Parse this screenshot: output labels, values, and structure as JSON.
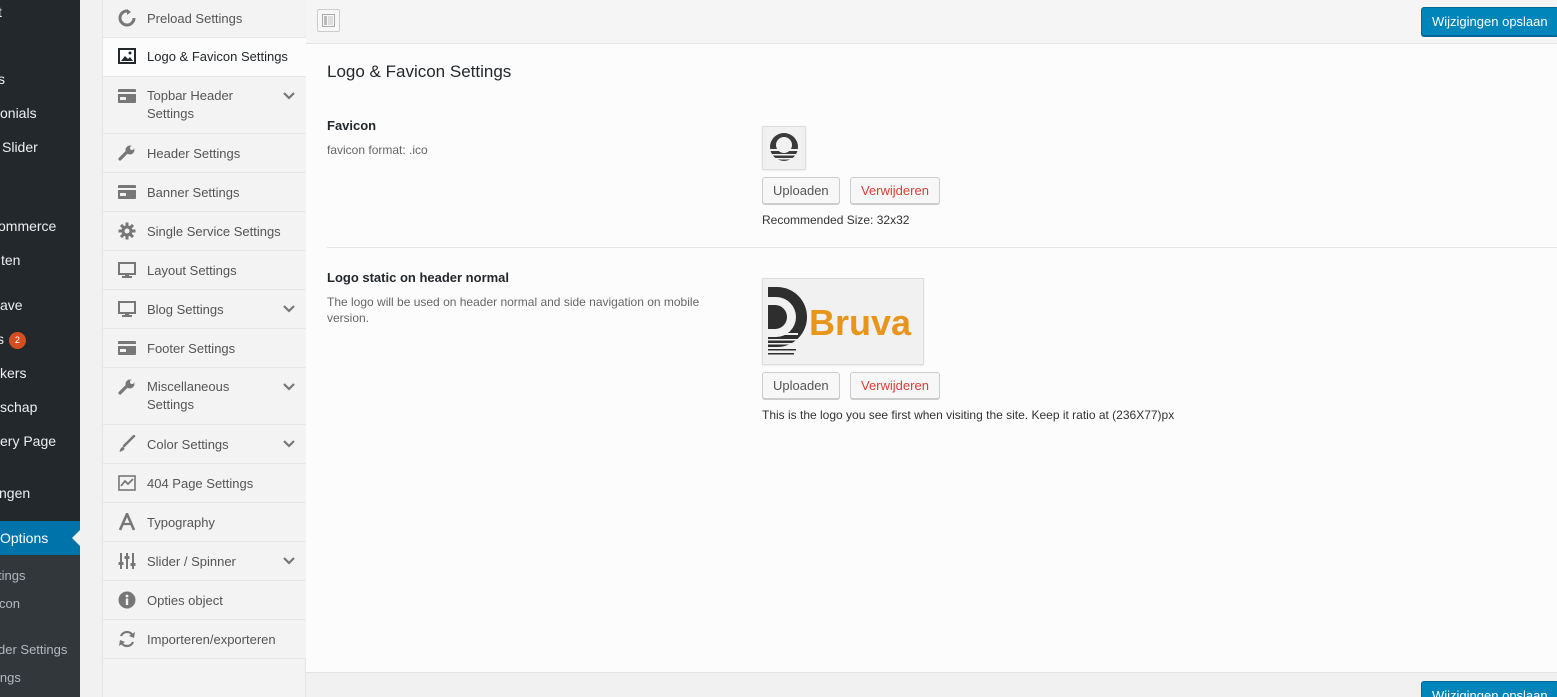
{
  "wp_menu": {
    "items": [
      "t",
      "s",
      "onials",
      "Slider",
      "ommerce",
      "ten",
      "ave",
      "s",
      "kers",
      "schap",
      "ery Page",
      "ngen",
      "Options"
    ],
    "badge": "2",
    "sub_items": [
      "tings",
      "con",
      "der Settings",
      "ings"
    ]
  },
  "nav": {
    "items": [
      {
        "label": "Preload Settings",
        "icon": "refresh-icon"
      },
      {
        "label": "Logo & Favicon Settings",
        "icon": "image-icon"
      },
      {
        "label": "Topbar Header Settings",
        "icon": "card-icon"
      },
      {
        "label": "Header Settings",
        "icon": "wrench-icon"
      },
      {
        "label": "Banner Settings",
        "icon": "card-icon"
      },
      {
        "label": "Single Service Settings",
        "icon": "gear-icon"
      },
      {
        "label": "Layout Settings",
        "icon": "monitor-icon"
      },
      {
        "label": "Blog Settings",
        "icon": "monitor-icon"
      },
      {
        "label": "Footer Settings",
        "icon": "card-icon"
      },
      {
        "label": "Miscellaneous Settings",
        "icon": "wrench-icon"
      },
      {
        "label": "Color Settings",
        "icon": "brush-icon"
      },
      {
        "label": "404 Page Settings",
        "icon": "chart-icon"
      },
      {
        "label": "Typography",
        "icon": "font-icon"
      },
      {
        "label": "Slider / Spinner",
        "icon": "sliders-icon"
      },
      {
        "label": "Opties object",
        "icon": "info-icon"
      },
      {
        "label": "Importeren/exporteren",
        "icon": "sync-icon"
      }
    ]
  },
  "toolbar": {
    "save_label": "Wijzigingen opslaan"
  },
  "content": {
    "title": "Logo & Favicon Settings",
    "favicon": {
      "title": "Favicon",
      "desc": "favicon format: .ico",
      "upload": "Uploaden",
      "remove": "Verwijderen",
      "note": "Recommended Size: 32x32"
    },
    "logo": {
      "title": "Logo static on header normal",
      "desc": "The logo will be used on header normal and side navigation on mobile version.",
      "upload": "Uploaden",
      "remove": "Verwijderen",
      "note": "This is the logo you see first when visiting the site. Keep it ratio at (236X77)px",
      "brand": "Bruva"
    }
  },
  "colors": {
    "primary": "#0085ba",
    "wp_sidebar": "#23282d",
    "active": "#0073aa",
    "danger": "#dd3d36",
    "logo_orange": "#e8951c"
  }
}
